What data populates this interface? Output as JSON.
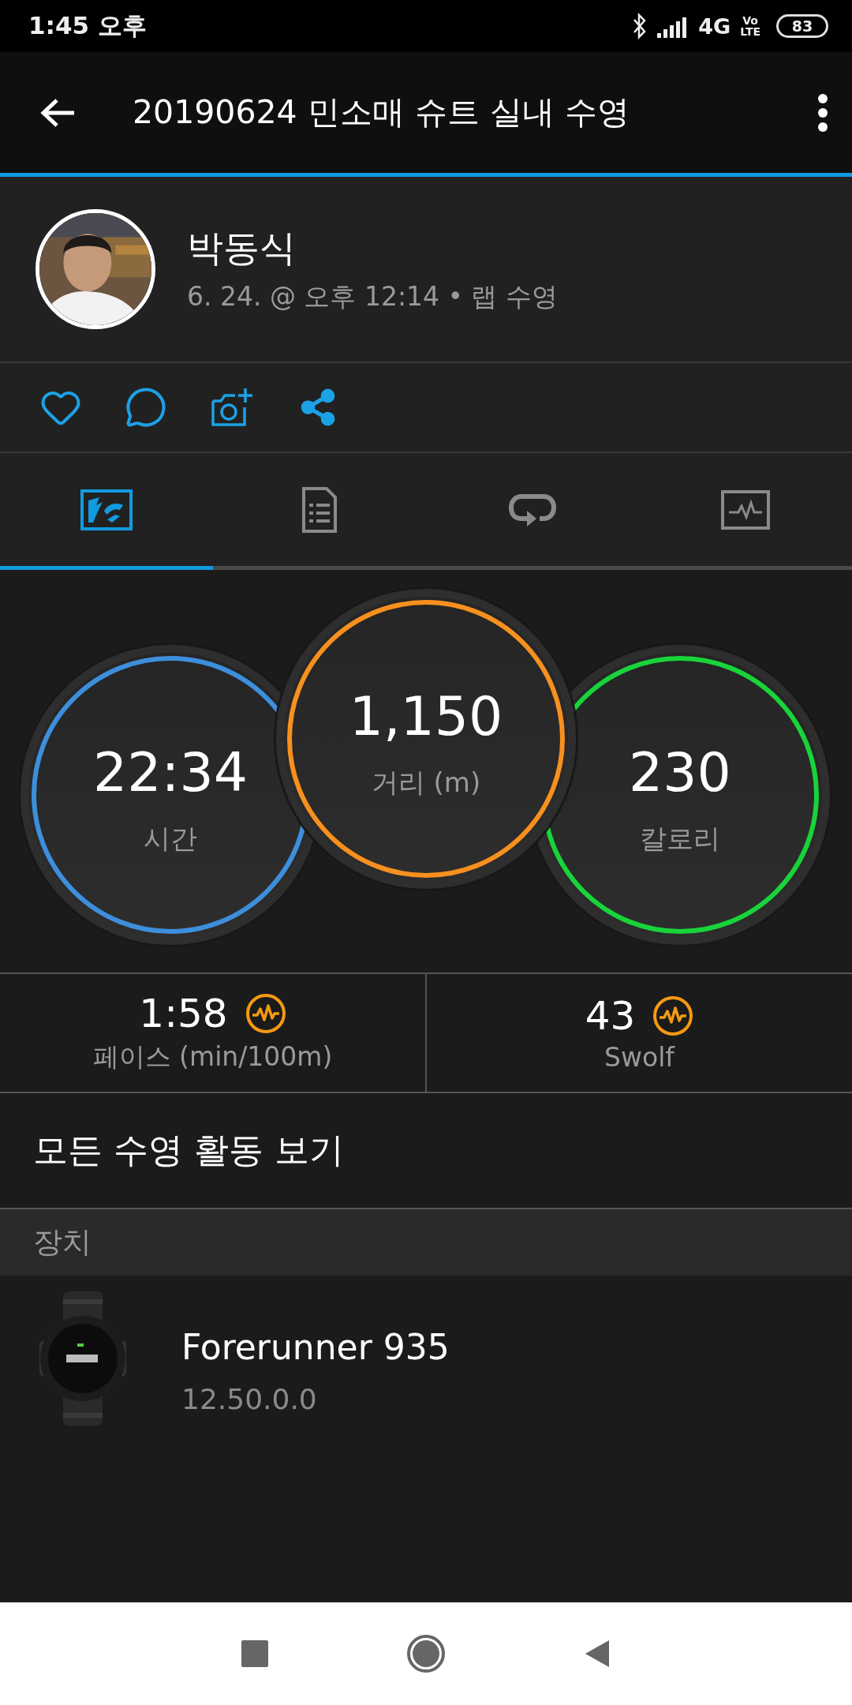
{
  "status_bar": {
    "time": "1:45 오후",
    "network": "4G",
    "volte_top": "Vo",
    "volte_bottom": "LTE",
    "battery": "83"
  },
  "header": {
    "title": "20190624 민소매 슈트 실내 수영"
  },
  "profile": {
    "name": "박동식",
    "subtitle": "6. 24. @ 오후 12:14 • 랩 수영"
  },
  "tabs": [
    {
      "kind": "overview",
      "selected": true
    },
    {
      "kind": "details",
      "selected": false
    },
    {
      "kind": "laps",
      "selected": false
    },
    {
      "kind": "chart",
      "selected": false
    }
  ],
  "metrics": [
    {
      "value": "22:34",
      "label": "시간",
      "color": "#3d8fdc"
    },
    {
      "value": "1,150",
      "label": "거리 (m)",
      "color": "#f7901e"
    },
    {
      "value": "230",
      "label": "칼로리",
      "color": "#18d43a"
    }
  ],
  "stats": [
    {
      "value": "1:58",
      "label": "페이스 (min/100m)"
    },
    {
      "value": "43",
      "label": "Swolf"
    }
  ],
  "link": "모든 수영 활동 보기",
  "devices_header": "장치",
  "device": {
    "name": "Forerunner 935",
    "version": "12.50.0.0"
  }
}
